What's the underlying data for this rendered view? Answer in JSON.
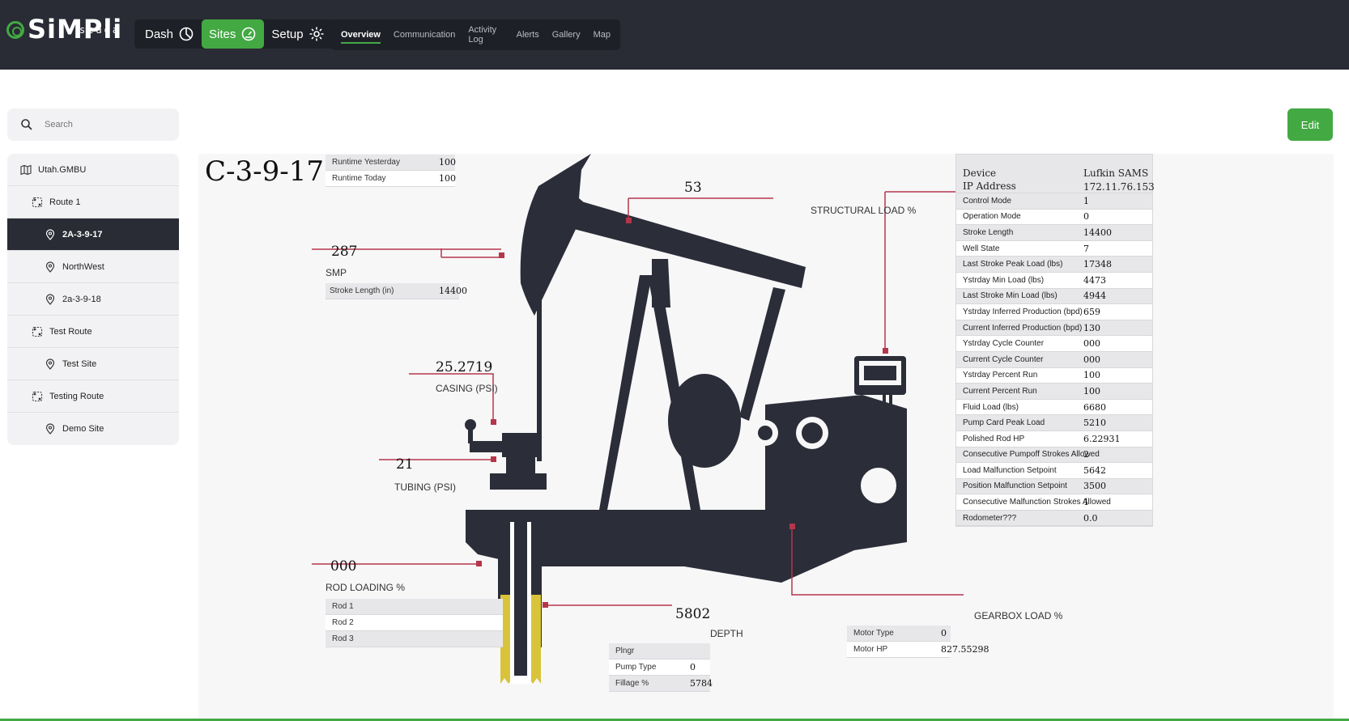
{
  "brand": {
    "name": "SiMPli",
    "sub": "scada",
    "accent": "#43a943",
    "dark": "#292c35",
    "marker": "#b5364a",
    "gold": "#d9c33a"
  },
  "nav": {
    "dash": "Dash",
    "sites": "Sites",
    "setup": "Setup",
    "tabs": [
      "Overview",
      "Communication",
      "Activity Log",
      "Alerts",
      "Gallery",
      "Map"
    ]
  },
  "search": {
    "placeholder": "Search"
  },
  "tree": [
    {
      "label": "Utah.GMBU",
      "icon": "map-icon"
    },
    {
      "label": "Route 1",
      "icon": "route-icon"
    },
    {
      "label": "2A-3-9-17",
      "icon": "location-pin-icon",
      "selected": true
    },
    {
      "label": "NorthWest",
      "icon": "location-pin-icon"
    },
    {
      "label": "2a-3-9-18",
      "icon": "location-pin-icon"
    },
    {
      "label": "Test Route",
      "icon": "route-icon"
    },
    {
      "label": "Test Site",
      "icon": "location-pin-icon"
    },
    {
      "label": "Testing Route",
      "icon": "route-icon"
    },
    {
      "label": "Demo Site",
      "icon": "location-pin-icon"
    }
  ],
  "edit_label": "Edit",
  "site": {
    "title": "C-3-9-17",
    "runtime": [
      {
        "label": "Runtime Yesterday",
        "value": "100"
      },
      {
        "label": "Runtime Today",
        "value": "100"
      }
    ],
    "smp": {
      "value": "287",
      "label": "SMP",
      "stroke_label": "Stroke Length (in)",
      "stroke_value": "14400"
    },
    "structural": {
      "value": "53",
      "label": "STRUCTURAL LOAD %"
    },
    "casing": {
      "value": "25.2719",
      "label": "CASING (PSI)"
    },
    "tubing": {
      "value": "21",
      "label": "TUBING (PSI)"
    },
    "rod": {
      "value": "000",
      "label": "ROD LOADING %",
      "rows": [
        "Rod 1",
        "Rod 2",
        "Rod 3"
      ]
    },
    "depth": {
      "value": "5802",
      "label": "DEPTH"
    },
    "plunger": [
      {
        "label": "Plngr",
        "value": ""
      },
      {
        "label": "Pump Type",
        "value": "0"
      },
      {
        "label": "Fillage %",
        "value": "5784"
      }
    ],
    "gearbox": {
      "label": "GEARBOX LOAD %"
    },
    "motor": [
      {
        "label": "Motor Type",
        "value": "0"
      },
      {
        "label": "Motor HP",
        "value": "827.55298"
      }
    ],
    "device": {
      "device_label": "Device",
      "device_value": "Lufkin SAMS",
      "ip_label": "IP Address",
      "ip_value": "172.11.76.153",
      "rows": [
        {
          "k": "Control Mode",
          "v": "1"
        },
        {
          "k": "Operation Mode",
          "v": "0"
        },
        {
          "k": "Stroke Length",
          "v": "14400"
        },
        {
          "k": "Well State",
          "v": "7"
        },
        {
          "k": "Last Stroke Peak Load (lbs)",
          "v": "17348"
        },
        {
          "k": "Ystrday Min Load (lbs)",
          "v": "4473"
        },
        {
          "k": "Last Stroke Min Load (lbs)",
          "v": "4944"
        },
        {
          "k": "Ystrday Inferred Production (bpd)",
          "v": "659"
        },
        {
          "k": "Current Inferred Production (bpd)",
          "v": "130"
        },
        {
          "k": "Ystrday Cycle Counter",
          "v": "000"
        },
        {
          "k": "Current Cycle Counter",
          "v": "000"
        },
        {
          "k": "Ystrday Percent Run",
          "v": "100"
        },
        {
          "k": "Current Percent Run",
          "v": "100"
        },
        {
          "k": "Fluid Load (lbs)",
          "v": "6680"
        },
        {
          "k": "Pump Card Peak Load",
          "v": "5210"
        },
        {
          "k": "Polished Rod HP",
          "v": "6.22931"
        },
        {
          "k": "Consecutive Pumpoff Strokes Allowed",
          "v": "2"
        },
        {
          "k": "Load Malfunction Setpoint",
          "v": "5642"
        },
        {
          "k": "Position Malfunction Setpoint",
          "v": "3500"
        },
        {
          "k": "Consecutive Malfunction Strokes Allowed",
          "v": "1"
        },
        {
          "k": "Rodometer???",
          "v": "0.0"
        }
      ]
    }
  }
}
